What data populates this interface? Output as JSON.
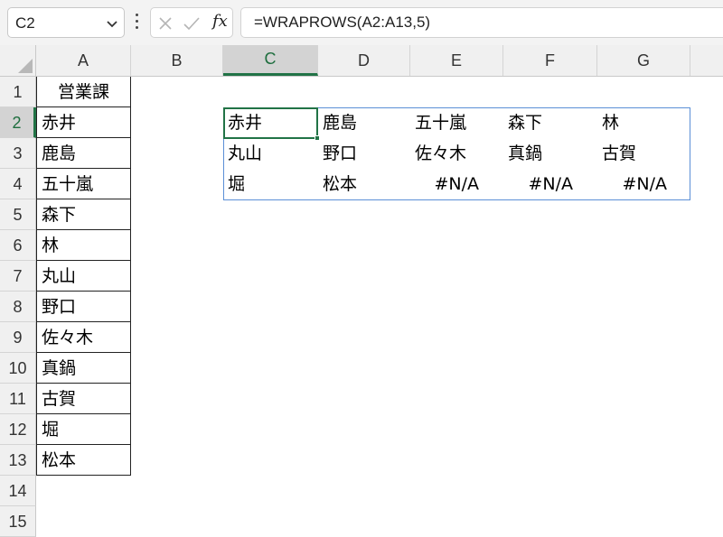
{
  "formula_bar": {
    "name_box": "C2",
    "fx_label": "fx",
    "formula": "=WRAPROWS(A2:A13,5)"
  },
  "columns": [
    "A",
    "B",
    "C",
    "D",
    "E",
    "F",
    "G"
  ],
  "selected_column": "C",
  "rows": [
    "1",
    "2",
    "3",
    "4",
    "5",
    "6",
    "7",
    "8",
    "9",
    "10",
    "11",
    "12",
    "13",
    "14",
    "15"
  ],
  "selected_row": "2",
  "column_a": {
    "header": "営業課",
    "values": [
      "赤井",
      "鹿島",
      "五十嵐",
      "森下",
      "林",
      "丸山",
      "野口",
      "佐々木",
      "真鍋",
      "古賀",
      "堀",
      "松本"
    ]
  },
  "spill": {
    "rows": [
      [
        "赤井",
        "鹿島",
        "五十嵐",
        "森下",
        "林"
      ],
      [
        "丸山",
        "野口",
        "佐々木",
        "真鍋",
        "古賀"
      ],
      [
        "堀",
        "松本",
        "#N/A",
        "#N/A",
        "#N/A"
      ]
    ]
  },
  "colors": {
    "accent_green": "#217346",
    "spill_border": "#5b8fd6"
  }
}
